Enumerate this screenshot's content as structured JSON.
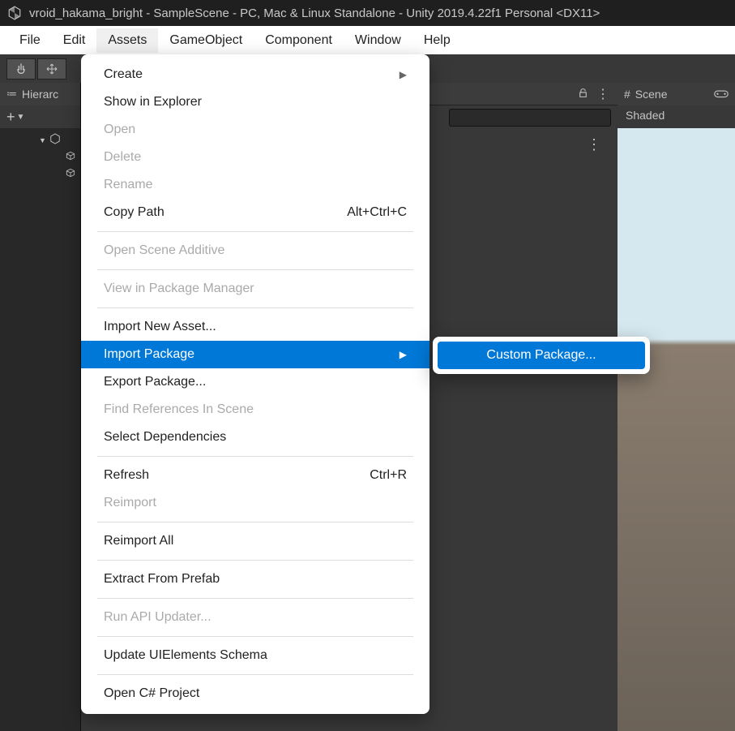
{
  "titlebar": {
    "text": "vroid_hakama_bright - SampleScene - PC, Mac & Linux Standalone - Unity 2019.4.22f1 Personal <DX11>"
  },
  "menubar": {
    "items": [
      "File",
      "Edit",
      "Assets",
      "GameObject",
      "Component",
      "Window",
      "Help"
    ],
    "active_index": 2
  },
  "hierarchy": {
    "title": "Hierarc",
    "add_label": "+"
  },
  "scene": {
    "title": "Scene",
    "shading": "Shaded"
  },
  "assets_menu": {
    "items": [
      {
        "label": "Create",
        "disabled": false,
        "submenu": true
      },
      {
        "label": "Show in Explorer",
        "disabled": false
      },
      {
        "label": "Open",
        "disabled": true
      },
      {
        "label": "Delete",
        "disabled": true
      },
      {
        "label": "Rename",
        "disabled": true
      },
      {
        "label": "Copy Path",
        "disabled": false,
        "shortcut": "Alt+Ctrl+C",
        "sep_after": true
      },
      {
        "label": "Open Scene Additive",
        "disabled": true,
        "sep_after": true
      },
      {
        "label": "View in Package Manager",
        "disabled": true,
        "sep_after": true
      },
      {
        "label": "Import New Asset...",
        "disabled": false
      },
      {
        "label": "Import Package",
        "disabled": false,
        "submenu": true,
        "highlight": true
      },
      {
        "label": "Export Package...",
        "disabled": false
      },
      {
        "label": "Find References In Scene",
        "disabled": true
      },
      {
        "label": "Select Dependencies",
        "disabled": false,
        "sep_after": true
      },
      {
        "label": "Refresh",
        "disabled": false,
        "shortcut": "Ctrl+R"
      },
      {
        "label": "Reimport",
        "disabled": true,
        "sep_after": true
      },
      {
        "label": "Reimport All",
        "disabled": false,
        "sep_after": true
      },
      {
        "label": "Extract From Prefab",
        "disabled": false,
        "sep_after": true
      },
      {
        "label": "Run API Updater...",
        "disabled": true,
        "sep_after": true
      },
      {
        "label": "Update UIElements Schema",
        "disabled": false,
        "sep_after": true
      },
      {
        "label": "Open C# Project",
        "disabled": false
      }
    ]
  },
  "import_package_submenu": {
    "items": [
      {
        "label": "Custom Package...",
        "highlight": true
      }
    ]
  }
}
